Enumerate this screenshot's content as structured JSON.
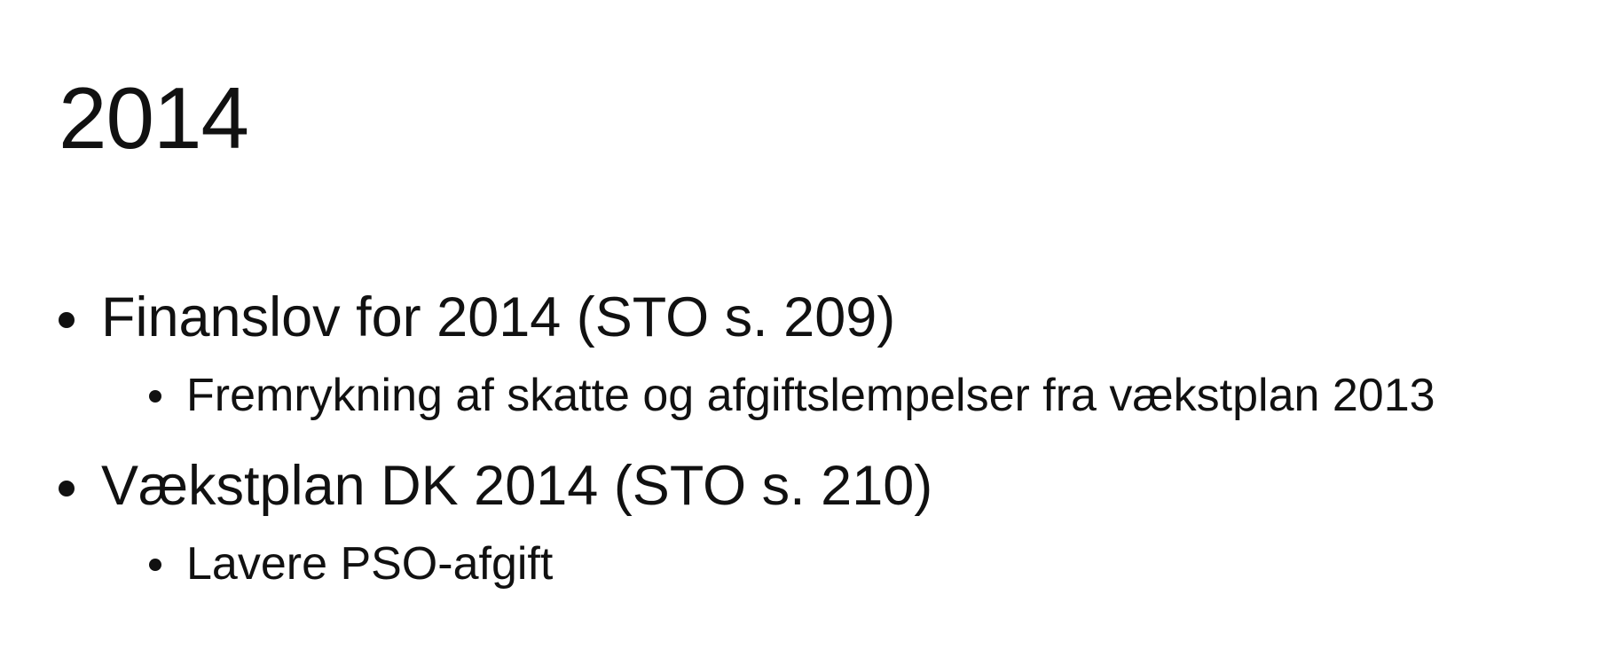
{
  "slide": {
    "title": "2014",
    "bullets": [
      {
        "text": "Finanslov for 2014 (STO s. 209)",
        "sub": [
          "Fremrykning af skatte og afgiftslempelser fra vækstplan 2013"
        ]
      },
      {
        "text": "Vækstplan DK 2014 (STO s. 210)",
        "sub": [
          "Lavere PSO-afgift"
        ]
      }
    ]
  }
}
